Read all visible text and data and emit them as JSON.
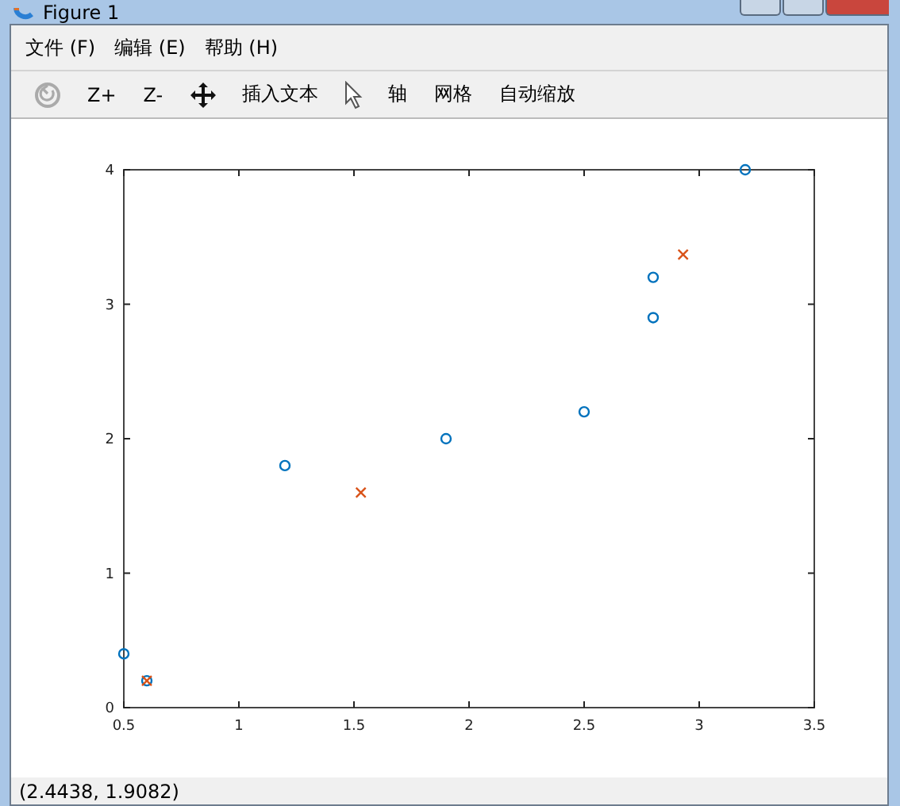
{
  "window": {
    "title": "Figure 1"
  },
  "menu": [
    "文件 (F)",
    "编辑 (E)",
    "帮助 (H)"
  ],
  "toolbar": [
    {
      "kind": "rotate",
      "disabled": true
    },
    {
      "kind": "text",
      "label": "Z+"
    },
    {
      "kind": "text",
      "label": "Z-"
    },
    {
      "kind": "pan"
    },
    {
      "kind": "text",
      "label": "插入文本"
    },
    {
      "kind": "select"
    },
    {
      "kind": "text",
      "label": "轴"
    },
    {
      "kind": "text",
      "label": "网格"
    },
    {
      "kind": "text",
      "label": "自动缩放"
    }
  ],
  "plot": {
    "chart_data": {
      "type": "scatter",
      "xlim": [
        0.5,
        3.5
      ],
      "ylim": [
        0,
        4
      ],
      "xticks": [
        0.5,
        1,
        1.5,
        2,
        2.5,
        3,
        3.5
      ],
      "yticks": [
        0,
        1,
        2,
        3,
        4
      ],
      "series": [
        {
          "marker": "circle",
          "color": "#0072bd",
          "x": [
            0.5,
            0.6,
            1.2,
            1.9,
            2.5,
            2.8,
            2.8,
            3.2
          ],
          "values": [
            0.4,
            0.2,
            1.8,
            2.0,
            2.2,
            2.9,
            3.2,
            4.0
          ]
        },
        {
          "marker": "cross",
          "color": "#d95319",
          "x": [
            0.6,
            1.53,
            2.93
          ],
          "values": [
            0.2,
            1.6,
            3.37
          ]
        }
      ]
    }
  },
  "status_bar": "(2.4438, 1.9082)"
}
